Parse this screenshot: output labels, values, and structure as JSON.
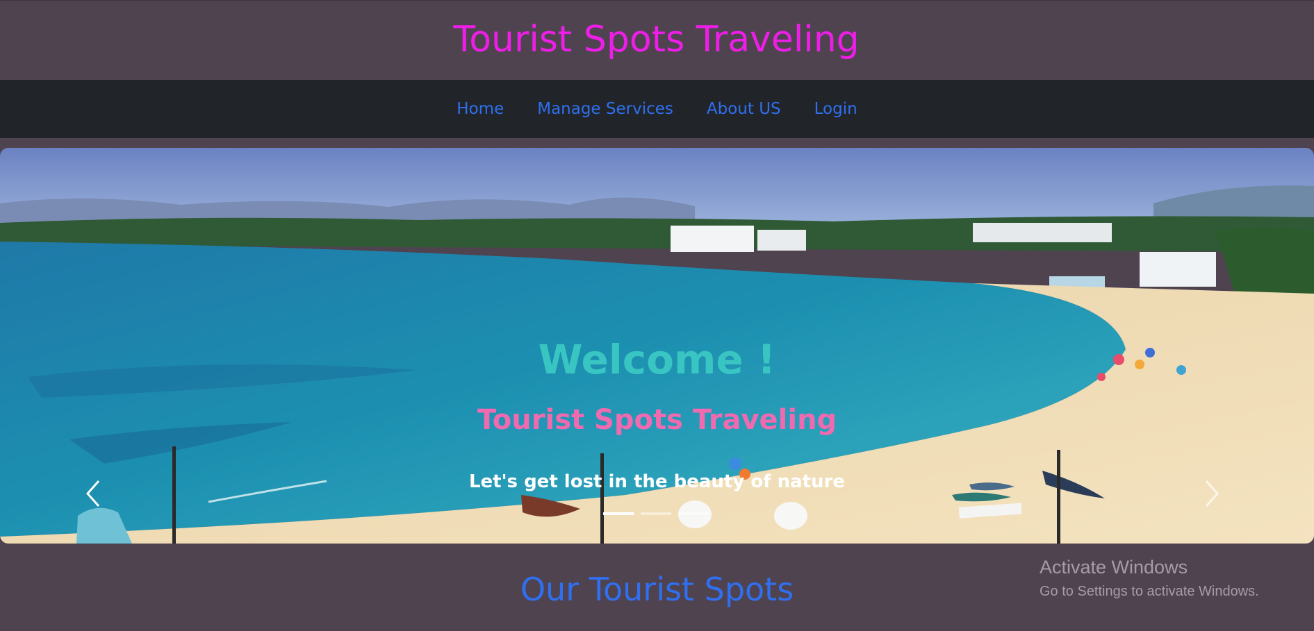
{
  "header": {
    "title": "Tourist Spots Traveling"
  },
  "nav": {
    "items": [
      {
        "label": "Home"
      },
      {
        "label": "Manage Services"
      },
      {
        "label": "About US"
      },
      {
        "label": "Login"
      }
    ]
  },
  "hero": {
    "title": "Welcome !",
    "subtitle": "Tourist Spots Traveling",
    "tagline": "Let's get lost in the beauty of nature",
    "slide_count": 3,
    "active_slide": 1
  },
  "section": {
    "heading": "Our Tourist Spots"
  },
  "watermark": {
    "title": "Activate Windows",
    "subtitle": "Go to Settings to activate Windows."
  },
  "colors": {
    "page_bg": "#4f4350",
    "navbar_bg": "#212529",
    "title": "#ee1ee8",
    "nav_link": "#2f6ff0",
    "welcome": "#39c6c3",
    "hero_subtitle": "#f06ab0",
    "section_heading": "#2f6ff0"
  },
  "icons": {
    "prev": "chevron-left-icon",
    "next": "chevron-right-icon"
  }
}
